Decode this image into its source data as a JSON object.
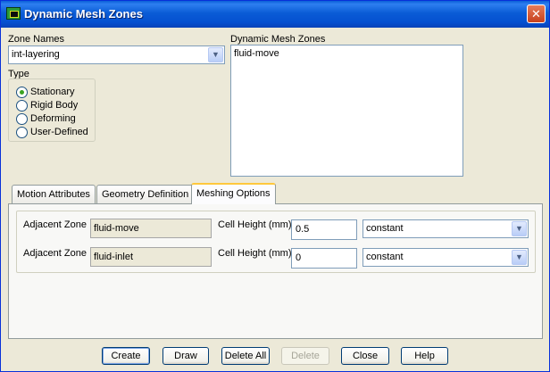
{
  "window": {
    "title": "Dynamic Mesh Zones"
  },
  "zone_names": {
    "label": "Zone Names",
    "selected": "int-layering"
  },
  "type": {
    "label": "Type",
    "options": [
      {
        "label": "Stationary",
        "selected": true
      },
      {
        "label": "Rigid Body",
        "selected": false
      },
      {
        "label": "Deforming",
        "selected": false
      },
      {
        "label": "User-Defined",
        "selected": false
      }
    ]
  },
  "dynamic_mesh_zones": {
    "label": "Dynamic Mesh Zones",
    "items": [
      "fluid-move"
    ]
  },
  "tabs": [
    {
      "label": "Motion Attributes",
      "active": false
    },
    {
      "label": "Geometry Definition",
      "active": false
    },
    {
      "label": "Meshing Options",
      "active": true
    }
  ],
  "meshing_rows": [
    {
      "adjacent_label": "Adjacent Zone",
      "adjacent_value": "fluid-move",
      "height_label": "Cell Height (mm)",
      "height_value": "0.5",
      "method": "constant"
    },
    {
      "adjacent_label": "Adjacent Zone",
      "adjacent_value": "fluid-inlet",
      "height_label": "Cell Height (mm)",
      "height_value": "0",
      "method": "constant"
    }
  ],
  "buttons": {
    "create": "Create",
    "draw": "Draw",
    "delete_all": "Delete All",
    "delete": "Delete",
    "close": "Close",
    "help": "Help"
  }
}
